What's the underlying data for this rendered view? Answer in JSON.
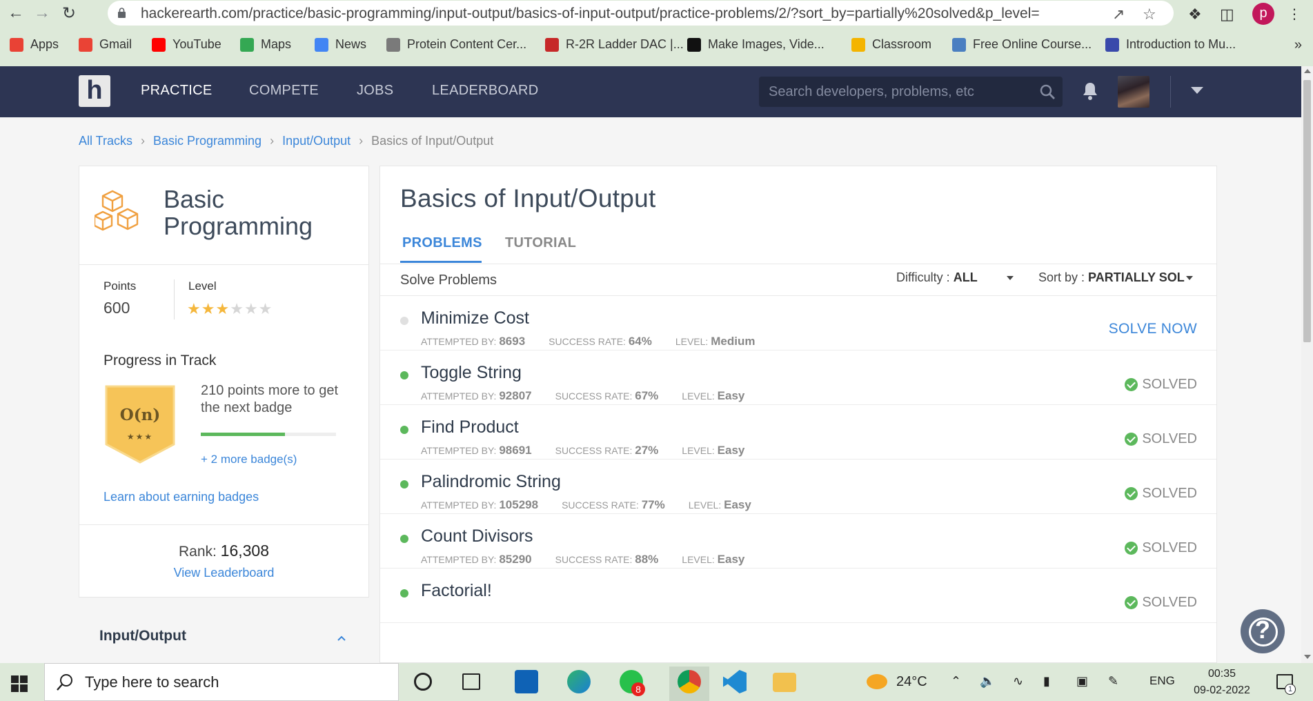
{
  "browser": {
    "url": "hackerearth.com/practice/basic-programming/input-output/basics-of-input-output/practice-problems/2/?sort_by=partially%20solved&p_level=",
    "profile_initial": "p",
    "bookmarks": [
      {
        "label": "Apps",
        "icon": "apps-grid-icon",
        "color": "#e94235"
      },
      {
        "label": "Gmail",
        "icon": "gmail-icon",
        "color": "#ea4335"
      },
      {
        "label": "YouTube",
        "icon": "youtube-icon",
        "color": "#ff0000"
      },
      {
        "label": "Maps",
        "icon": "maps-pin-icon",
        "color": "#34a853"
      },
      {
        "label": "News",
        "icon": "news-icon",
        "color": "#4285f4"
      },
      {
        "label": "Protein Content Cer...",
        "icon": "bookmark-site-icon",
        "color": "#7a7a7a"
      },
      {
        "label": "R-2R Ladder DAC |...",
        "icon": "ladder-site-icon",
        "color": "#c62828"
      },
      {
        "label": "Make Images, Vide...",
        "icon": "media-site-icon",
        "color": "#111111"
      },
      {
        "label": "Classroom",
        "icon": "classroom-icon",
        "color": "#f4b400"
      },
      {
        "label": "Free Online Course...",
        "icon": "courses-site-icon",
        "color": "#4a7fc1"
      },
      {
        "label": "Introduction to Mu...",
        "icon": "quizlet-icon",
        "color": "#3949ab"
      }
    ]
  },
  "site": {
    "logo_letter": "h",
    "nav": [
      {
        "label": "PRACTICE",
        "active": true
      },
      {
        "label": "COMPETE",
        "active": false
      },
      {
        "label": "JOBS",
        "active": false
      },
      {
        "label": "LEADERBOARD",
        "active": false
      }
    ],
    "search_placeholder": "Search developers, problems, etc"
  },
  "breadcrumb": {
    "items": [
      "All Tracks",
      "Basic Programming",
      "Input/Output"
    ],
    "current": "Basics of Input/Output"
  },
  "sidebar": {
    "track_title": "Basic Programming",
    "points_label": "Points",
    "points_value": "600",
    "level_label": "Level",
    "level_stars_filled": 3,
    "level_stars_total": 6,
    "progress_title": "Progress in Track",
    "badge_text": "O(n)",
    "badge_stars": "★★★",
    "next_badge_text": "210 points more to get the next badge",
    "progress_fraction": 0.62,
    "more_badges": "+ 2 more badge(s)",
    "learn_link": "Learn about earning badges",
    "rank_label": "Rank:",
    "rank_value": "16,308",
    "view_leaderboard": "View Leaderboard",
    "section_title": "Input/Output"
  },
  "main": {
    "title": "Basics of Input/Output",
    "tabs": [
      {
        "label": "PROBLEMS",
        "active": true
      },
      {
        "label": "TUTORIAL",
        "active": false
      }
    ],
    "solve_header": "Solve Problems",
    "difficulty_label": "Difficulty :",
    "difficulty_value": "ALL",
    "sort_label": "Sort by :",
    "sort_value": "PARTIALLY SOL",
    "attempted_label": "ATTEMPTED BY:",
    "success_label": "SUCCESS RATE:",
    "level_label": "LEVEL:",
    "solve_now": "SOLVE NOW",
    "solved": "SOLVED",
    "problems": [
      {
        "name": "Minimize Cost",
        "attempted": "8693",
        "success": "64%",
        "level": "Medium",
        "status": "open"
      },
      {
        "name": "Toggle String",
        "attempted": "92807",
        "success": "67%",
        "level": "Easy",
        "status": "solved"
      },
      {
        "name": "Find Product",
        "attempted": "98691",
        "success": "27%",
        "level": "Easy",
        "status": "solved"
      },
      {
        "name": "Palindromic String",
        "attempted": "105298",
        "success": "77%",
        "level": "Easy",
        "status": "solved"
      },
      {
        "name": "Count Divisors",
        "attempted": "85290",
        "success": "88%",
        "level": "Easy",
        "status": "solved"
      },
      {
        "name": "Factorial!",
        "attempted": "",
        "success": "",
        "level": "",
        "status": "solved"
      }
    ]
  },
  "taskbar": {
    "search_placeholder": "Type here to search",
    "whatsapp_badge": "8",
    "temperature": "24°C",
    "language": "ENG",
    "time": "00:35",
    "date": "09-02-2022",
    "notification_count": "1"
  }
}
